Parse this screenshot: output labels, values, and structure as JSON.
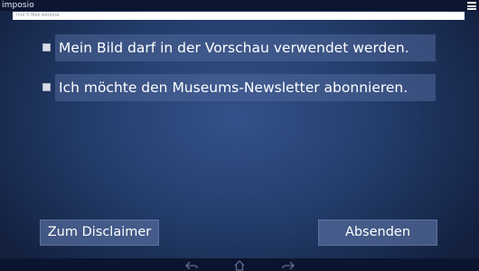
{
  "window": {
    "title": "imposio"
  },
  "email": {
    "value": "",
    "placeholder": "Ihre E-Mail-Adresse"
  },
  "options": [
    {
      "label": "Mein Bild darf in der Vorschau verwendet werden.",
      "checked": false
    },
    {
      "label": "Ich möchte den Museums-Newsletter abonnieren.",
      "checked": false
    }
  ],
  "buttons": {
    "disclaimer": "Zum Disclaimer",
    "submit": "Absenden"
  },
  "icons": {
    "menu": "hamburger-menu-icon",
    "back": "back-arrow-icon",
    "home": "home-icon",
    "forward": "forward-arrow-icon"
  },
  "colors": {
    "background": "#25406f",
    "panel": "#50689b",
    "titlebar": "#0c1630"
  }
}
